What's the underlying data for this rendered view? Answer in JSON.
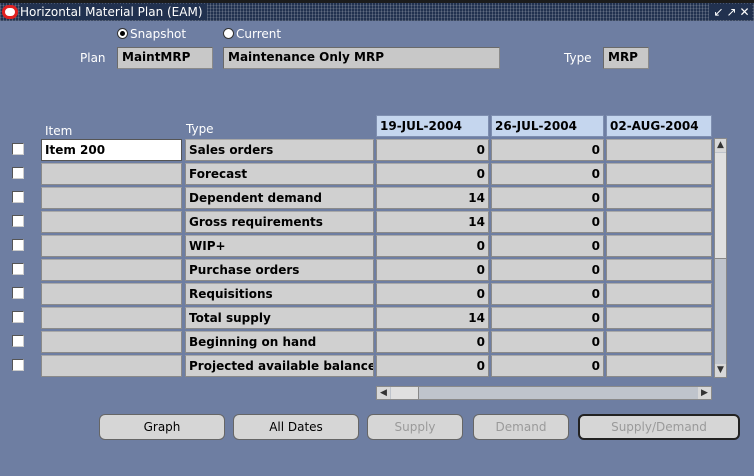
{
  "window": {
    "title": "Horizontal Material Plan (EAM)",
    "controls": [
      "↙",
      "↗",
      "✕"
    ]
  },
  "radios": [
    {
      "label": "Snapshot",
      "selected": true
    },
    {
      "label": "Current",
      "selected": false
    }
  ],
  "header": {
    "plan_label": "Plan",
    "plan_value": "MaintMRP",
    "plan_desc": "Maintenance Only MRP",
    "type_label": "Type",
    "type_value": "MRP"
  },
  "table": {
    "item_header": "Item",
    "type_header": "Type",
    "date_headers": [
      "19-JUL-2004",
      "26-JUL-2004",
      "02-AUG-2004"
    ],
    "item_value": "Item 200",
    "rows": [
      {
        "type": "Sales orders",
        "v1": "0",
        "v2": "0"
      },
      {
        "type": "Forecast",
        "v1": "0",
        "v2": "0"
      },
      {
        "type": "Dependent demand",
        "v1": "14",
        "v2": "0"
      },
      {
        "type": "Gross requirements",
        "v1": "14",
        "v2": "0"
      },
      {
        "type": "WIP+",
        "v1": "0",
        "v2": "0"
      },
      {
        "type": "Purchase orders",
        "v1": "0",
        "v2": "0"
      },
      {
        "type": "Requisitions",
        "v1": "0",
        "v2": "0"
      },
      {
        "type": "Total supply",
        "v1": "14",
        "v2": "0"
      },
      {
        "type": "Beginning on hand",
        "v1": "0",
        "v2": "0"
      },
      {
        "type": "Projected available balance",
        "v1": "0",
        "v2": "0"
      }
    ]
  },
  "buttons": {
    "graph": "Graph",
    "all_dates": "All Dates",
    "supply": "Supply",
    "demand": "Demand",
    "supply_demand": "Supply/Demand"
  },
  "colors": {
    "background": "#6e7ea2",
    "titlebar": "#21314f",
    "date_header": "#c5d6ee"
  }
}
